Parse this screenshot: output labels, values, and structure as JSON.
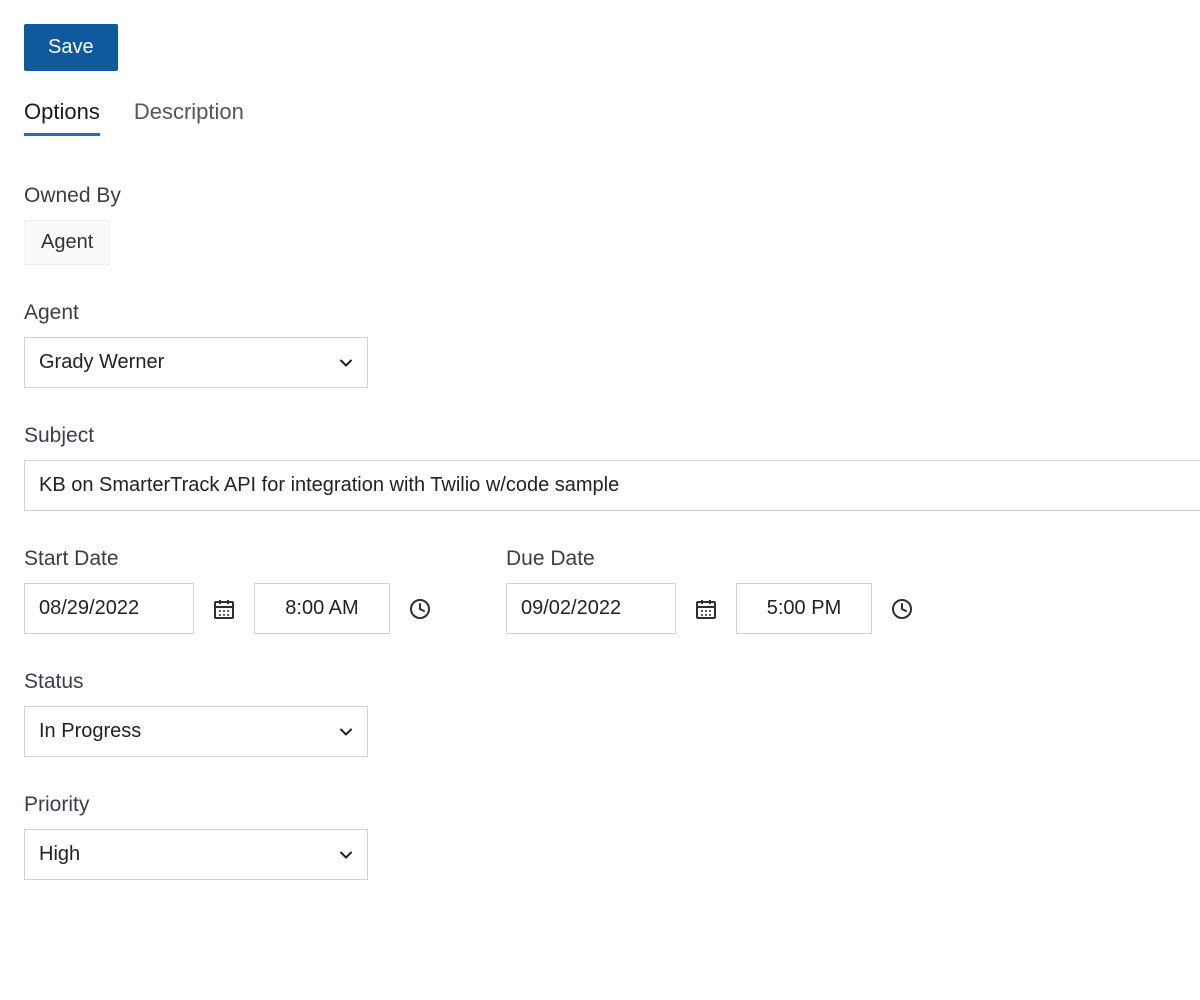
{
  "toolbar": {
    "save_label": "Save"
  },
  "tabs": {
    "options": "Options",
    "description": "Description"
  },
  "fields": {
    "owned_by": {
      "label": "Owned By",
      "value": "Agent"
    },
    "agent": {
      "label": "Agent",
      "value": "Grady Werner"
    },
    "subject": {
      "label": "Subject",
      "value": "KB on SmarterTrack API for integration with Twilio w/code sample"
    },
    "start_date": {
      "label": "Start Date",
      "date": "08/29/2022",
      "time": "8:00 AM"
    },
    "due_date": {
      "label": "Due Date",
      "date": "09/02/2022",
      "time": "5:00 PM"
    },
    "status": {
      "label": "Status",
      "value": "In Progress"
    },
    "priority": {
      "label": "Priority",
      "value": "High"
    }
  }
}
